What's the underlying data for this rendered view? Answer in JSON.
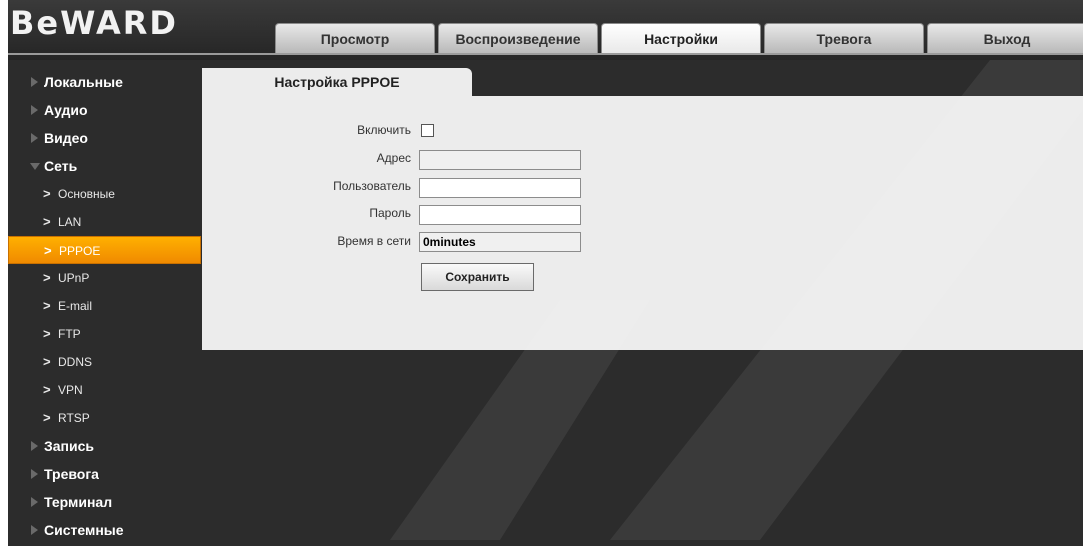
{
  "brand": {
    "logo_text": "BeWARD"
  },
  "tabs": [
    {
      "label": "Просмотр",
      "active": false
    },
    {
      "label": "Воспроизведение",
      "active": false
    },
    {
      "label": "Настройки",
      "active": true
    },
    {
      "label": "Тревога",
      "active": false
    },
    {
      "label": "Выход",
      "active": false
    }
  ],
  "sidebar": {
    "menu": [
      {
        "label": "Локальные",
        "expanded": false
      },
      {
        "label": "Аудио",
        "expanded": false
      },
      {
        "label": "Видео",
        "expanded": false
      },
      {
        "label": "Сеть",
        "expanded": true
      },
      {
        "label": "Запись",
        "expanded": false
      },
      {
        "label": "Тревога",
        "expanded": false
      },
      {
        "label": "Терминал",
        "expanded": false
      },
      {
        "label": "Системные",
        "expanded": false
      }
    ],
    "network_subitems": [
      {
        "label": "Основные",
        "active": false
      },
      {
        "label": "LAN",
        "active": false
      },
      {
        "label": "PPPOE",
        "active": true
      },
      {
        "label": "UPnP",
        "active": false
      },
      {
        "label": "E-mail",
        "active": false
      },
      {
        "label": "FTP",
        "active": false
      },
      {
        "label": "DDNS",
        "active": false
      },
      {
        "label": "VPN",
        "active": false
      },
      {
        "label": "RTSP",
        "active": false
      }
    ]
  },
  "panel": {
    "tab_title": "Настройка PPPOE",
    "enable": {
      "label": "Включить",
      "checked": false
    },
    "address": {
      "label": "Адрес",
      "value": ""
    },
    "user": {
      "label": "Пользователь",
      "value": ""
    },
    "password": {
      "label": "Пароль",
      "value": ""
    },
    "online_time": {
      "label": "Время в сети",
      "value": "0minutes"
    },
    "save_label": "Сохранить"
  },
  "colors": {
    "active_item": "#f59a00",
    "background": "#2c2c2c",
    "panel": "#ececec"
  }
}
